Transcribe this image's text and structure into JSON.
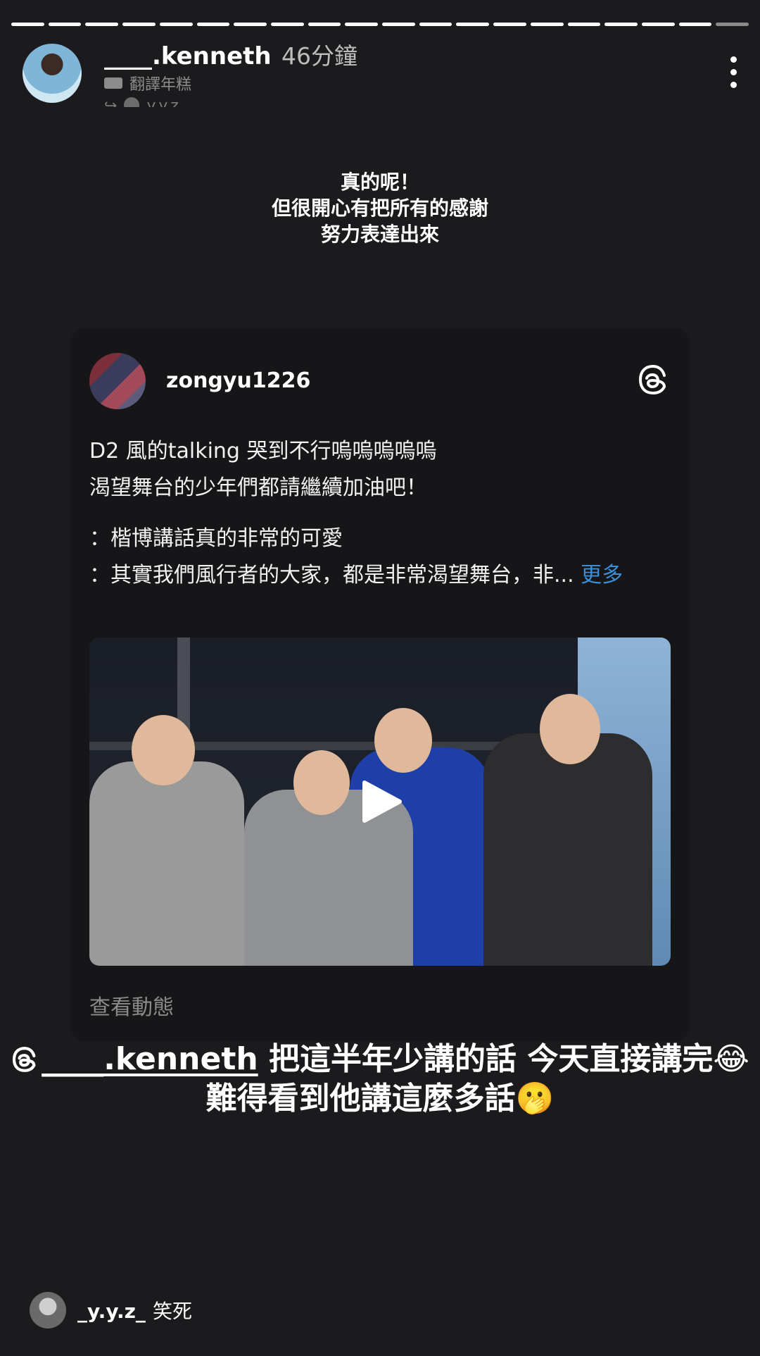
{
  "story": {
    "segments": 20,
    "username": "____.kenneth",
    "time": "46分鐘",
    "translate_label": "翻譯年糕",
    "reshare_user": "y.y.z"
  },
  "story_text": {
    "lines": [
      "真的呢！",
      "但很開心有把所有的感謝",
      "努力表達出來"
    ]
  },
  "card": {
    "username": "zongyu1226",
    "line1": "D2 風的talking 哭到不行嗚嗚嗚嗚嗚",
    "line2": "渴望舞台的少年們都請繼續加油吧！",
    "line3": "：楷博講話真的非常的可愛",
    "line4": "：其實我們風行者的大家，都是非常渴望舞台，非...",
    "more_label": "更多",
    "view_link": "查看動態"
  },
  "caption": {
    "mention": "____.kenneth",
    "line1_rest": " 把這半年少講的話 今天直接講完😂",
    "line2": "難得看到他講這麼多話🫢"
  },
  "reply": {
    "username": "_y.y.z_",
    "text": "笑死"
  }
}
